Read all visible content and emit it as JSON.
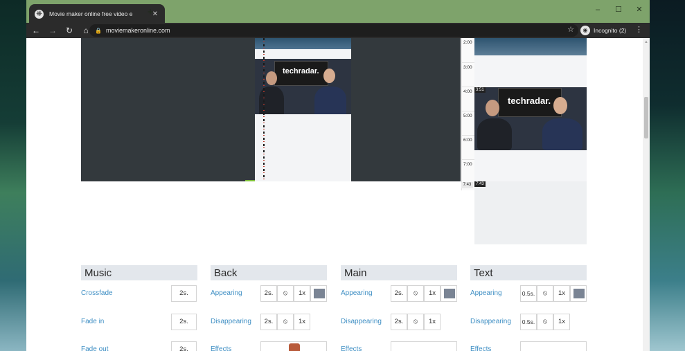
{
  "browser": {
    "tab_title": "Movie maker online free video e",
    "new_tab_label": "+",
    "url": "moviemakeronline.com",
    "incognito_label": "Incognito (2)",
    "window_controls": [
      "–",
      "☐",
      "✕"
    ]
  },
  "timeline": {
    "time_ticks": [
      "2:00",
      "3:00",
      "4:00",
      "5:00",
      "6:00",
      "7:00"
    ],
    "end_time": "7:43",
    "thumb_badge_start": "3:51",
    "thumb_badge_end": "7:43",
    "logo_text": "techradar."
  },
  "panels": [
    {
      "title": "Music",
      "rows": [
        {
          "label": "Crossfade",
          "value": "2s."
        },
        {
          "label": "Fade in",
          "value": "2s."
        },
        {
          "label": "Fade out",
          "value": "2s."
        }
      ]
    },
    {
      "title": "Back",
      "rows": [
        {
          "label": "Appearing",
          "duration": "2s.",
          "speed": "1x"
        },
        {
          "label": "Disappearing",
          "duration": "2s.",
          "speed": "1x"
        },
        {
          "label": "Effects"
        }
      ]
    },
    {
      "title": "Main",
      "rows": [
        {
          "label": "Appearing",
          "duration": "2s.",
          "speed": "1x"
        },
        {
          "label": "Disappearing",
          "duration": "2s.",
          "speed": "1x"
        },
        {
          "label": "Effects"
        }
      ]
    },
    {
      "title": "Text",
      "rows": [
        {
          "label": "Appearing",
          "duration": "0.5s.",
          "speed": "1x"
        },
        {
          "label": "Disappearing",
          "duration": "0.5s.",
          "speed": "1x"
        },
        {
          "label": "Effects"
        }
      ]
    }
  ],
  "colors": {
    "frame_titlebar": "#7ea36b",
    "link_blue": "#3f8fc4",
    "panel_header": "#e3e7ec",
    "editor_dark": "#33393d"
  },
  "icons": {
    "block": "⦸"
  }
}
